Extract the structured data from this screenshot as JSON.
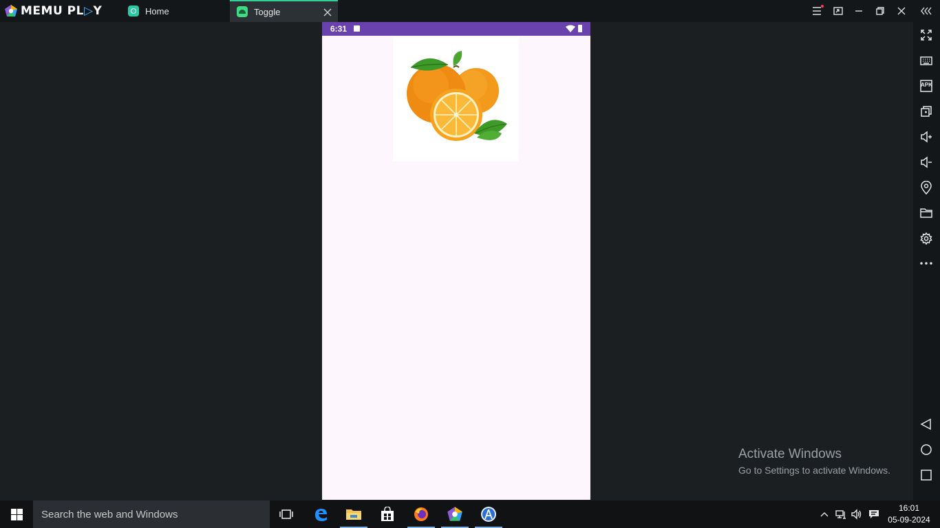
{
  "titlebar": {
    "brand_left": "MEMU PL",
    "brand_accent": "▷",
    "brand_right": "Y",
    "tabs": [
      {
        "label": "Home",
        "icon": "memu-home-icon",
        "active": false
      },
      {
        "label": "Toggle",
        "icon": "android-app-icon",
        "active": true
      }
    ],
    "accent_color": "#32d29a"
  },
  "android": {
    "status_time": "6:31",
    "status_bar_color": "#6a42ae",
    "background": "#fdf6fd",
    "image_subject": "oranges"
  },
  "toolbar": {
    "tools": [
      "fullscreen-icon",
      "keyboard-icon",
      "apk-icon",
      "multi-instance-icon",
      "volume-up-icon",
      "volume-down-icon",
      "location-icon",
      "folder-icon",
      "settings-icon",
      "more-icon",
      "back-icon",
      "home-icon",
      "recents-icon"
    ],
    "apk_label": "APK"
  },
  "watermark": {
    "title": "Activate Windows",
    "subtitle": "Go to Settings to activate Windows."
  },
  "taskbar": {
    "search_placeholder": "Search the web and Windows",
    "apps": [
      "task-view-icon",
      "edge-icon",
      "file-explorer-icon",
      "store-icon",
      "firefox-icon",
      "memu-icon",
      "android-studio-icon"
    ],
    "clock_time": "16:01",
    "clock_date": "05-09-2024"
  }
}
